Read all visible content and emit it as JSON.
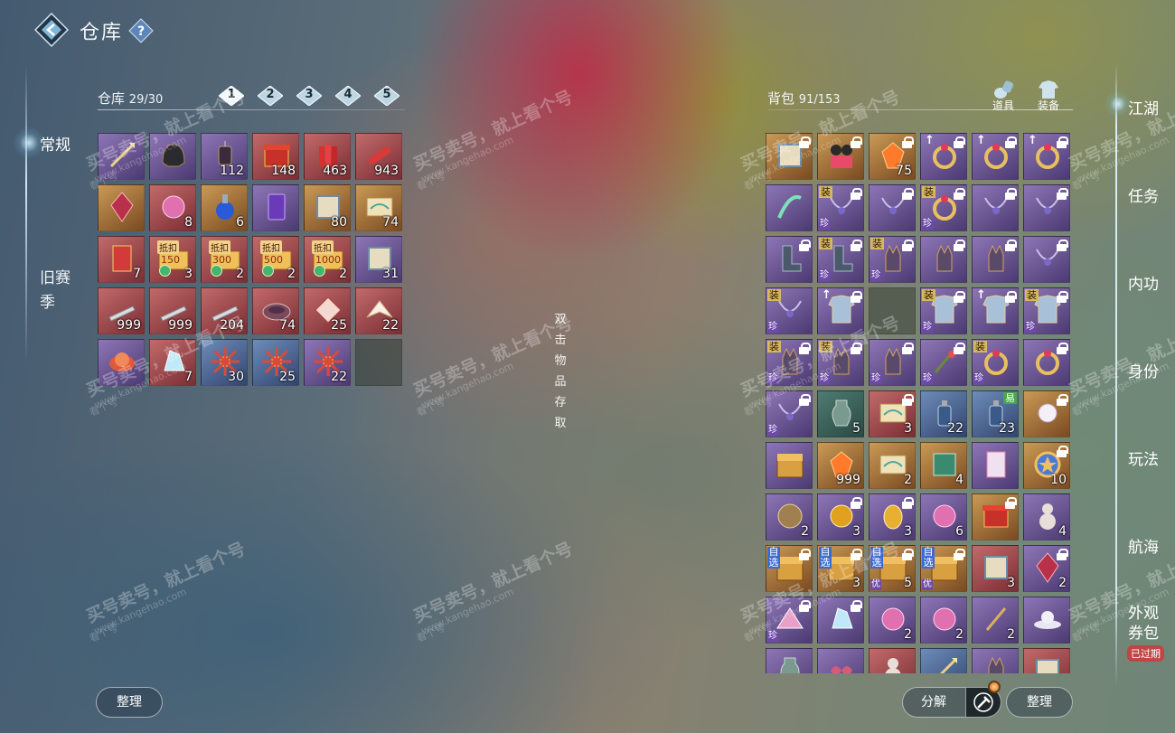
{
  "header": {
    "title": "仓库",
    "help": "?"
  },
  "left_nav": [
    {
      "label": "常规",
      "active": true
    },
    {
      "label": "旧赛季",
      "active": false
    }
  ],
  "warehouse": {
    "label": "仓库",
    "capacity": "29/30",
    "pages": [
      "1",
      "2",
      "3",
      "4",
      "5"
    ],
    "active_page": "1",
    "items": [
      {
        "c": "purple",
        "i": "spear",
        "n": ""
      },
      {
        "c": "purple",
        "i": "helmet",
        "n": ""
      },
      {
        "c": "purple",
        "i": "lantern",
        "n": "112"
      },
      {
        "c": "red",
        "i": "box",
        "n": "148"
      },
      {
        "c": "red",
        "i": "firecracker",
        "n": "463"
      },
      {
        "c": "red",
        "i": "scroll",
        "n": "943"
      },
      {
        "c": "gold",
        "i": "crystal",
        "n": ""
      },
      {
        "c": "red",
        "i": "orb",
        "n": "8"
      },
      {
        "c": "gold",
        "i": "potion",
        "n": "6"
      },
      {
        "c": "purple",
        "i": "card",
        "n": ""
      },
      {
        "c": "gold",
        "i": "book",
        "n": "80"
      },
      {
        "c": "gold",
        "i": "map",
        "n": "74"
      },
      {
        "c": "red",
        "i": "envelope",
        "n": "7"
      },
      {
        "c": "red",
        "i": "coupon",
        "n": "3",
        "tag": "抵扣",
        "val": "150"
      },
      {
        "c": "red",
        "i": "coupon",
        "n": "2",
        "tag": "抵扣",
        "val": "300"
      },
      {
        "c": "red",
        "i": "coupon",
        "n": "2",
        "tag": "抵扣",
        "val": "500"
      },
      {
        "c": "red",
        "i": "coupon",
        "n": "2",
        "tag": "抵扣",
        "val": "1000"
      },
      {
        "c": "purple",
        "i": "book",
        "n": "31"
      },
      {
        "c": "red",
        "i": "blade",
        "n": "999"
      },
      {
        "c": "red",
        "i": "blade",
        "n": "999"
      },
      {
        "c": "red",
        "i": "blade",
        "n": "204"
      },
      {
        "c": "red",
        "i": "bowl",
        "n": "74"
      },
      {
        "c": "red",
        "i": "kite",
        "n": "25"
      },
      {
        "c": "red",
        "i": "crane",
        "n": "22"
      },
      {
        "c": "purple",
        "i": "lotus",
        "n": ""
      },
      {
        "c": "red",
        "i": "ice",
        "n": "7"
      },
      {
        "c": "blue",
        "i": "star",
        "n": "30"
      },
      {
        "c": "blue",
        "i": "star",
        "n": "25"
      },
      {
        "c": "purple",
        "i": "star",
        "n": "22"
      },
      {
        "c": "empty",
        "i": "",
        "n": ""
      }
    ]
  },
  "hint": "双击物品存取",
  "bag": {
    "label": "背包",
    "capacity": "91/153",
    "tabs": [
      {
        "label": "道具",
        "icon": "potion-bag-icon"
      },
      {
        "label": "装备",
        "icon": "armor-icon"
      }
    ],
    "items": [
      {
        "c": "gold",
        "i": "book",
        "lk": 1
      },
      {
        "c": "gold",
        "i": "figures",
        "lk": 1
      },
      {
        "c": "gold",
        "i": "gem",
        "n": "75",
        "lk": 1
      },
      {
        "c": "purple",
        "i": "ring",
        "lk": 1,
        "up": 1
      },
      {
        "c": "purple",
        "i": "ring",
        "lk": 1,
        "up": 1
      },
      {
        "c": "purple",
        "i": "ring",
        "lk": 1,
        "up": 1
      },
      {
        "c": "purple",
        "i": "ribbon"
      },
      {
        "c": "purple",
        "i": "necklace",
        "lk": 1,
        "tl": "装",
        "bl": "珍"
      },
      {
        "c": "purple",
        "i": "necklace",
        "lk": 1
      },
      {
        "c": "purple",
        "i": "ring",
        "lk": 1,
        "tl": "装",
        "bl": "珍"
      },
      {
        "c": "purple",
        "i": "necklace",
        "lk": 1
      },
      {
        "c": "purple",
        "i": "necklace",
        "lk": 1
      },
      {
        "c": "purple",
        "i": "boots",
        "lk": 1
      },
      {
        "c": "purple",
        "i": "boots",
        "lk": 1,
        "tl": "装",
        "bl": "珍"
      },
      {
        "c": "purple",
        "i": "glove",
        "lk": 1,
        "tl": "装",
        "bl": "珍"
      },
      {
        "c": "purple",
        "i": "glove",
        "lk": 1
      },
      {
        "c": "purple",
        "i": "glove",
        "lk": 1
      },
      {
        "c": "purple",
        "i": "necklace",
        "lk": 1
      },
      {
        "c": "purple",
        "i": "necklace",
        "tl": "装",
        "bl": "珍"
      },
      {
        "c": "purple",
        "i": "armor",
        "lk": 1,
        "up": 1
      },
      {
        "c": "empty",
        "i": ""
      },
      {
        "c": "purple",
        "i": "armor",
        "lk": 1,
        "tl": "装",
        "bl": "珍"
      },
      {
        "c": "purple",
        "i": "armor",
        "lk": 1,
        "up": 1
      },
      {
        "c": "purple",
        "i": "armor",
        "lk": 1,
        "tl": "装",
        "bl": "珍"
      },
      {
        "c": "purple",
        "i": "glove",
        "lk": 1,
        "tl": "装",
        "bl": "珍"
      },
      {
        "c": "purple",
        "i": "glove",
        "lk": 1,
        "tl": "装",
        "bl": "珍"
      },
      {
        "c": "purple",
        "i": "glove",
        "lk": 1,
        "bl": "珍"
      },
      {
        "c": "purple",
        "i": "branch",
        "lk": 1,
        "bl": "珍"
      },
      {
        "c": "purple",
        "i": "ring",
        "tl": "装",
        "bl": "珍"
      },
      {
        "c": "purple",
        "i": "ring",
        "lk": 1
      },
      {
        "c": "purple",
        "i": "necklace",
        "lk": 1,
        "bl": "珍"
      },
      {
        "c": "green",
        "i": "vase",
        "n": "5"
      },
      {
        "c": "red",
        "i": "map",
        "n": "3",
        "lk": 1
      },
      {
        "c": "blue",
        "i": "bottle",
        "n": "22"
      },
      {
        "c": "blue",
        "i": "bottle",
        "n": "23",
        "tl2": "易"
      },
      {
        "c": "gold",
        "i": "pearl",
        "lk": 1
      },
      {
        "c": "purple",
        "i": "chest"
      },
      {
        "c": "gold",
        "i": "gem",
        "n": "999"
      },
      {
        "c": "gold",
        "i": "map",
        "n": "2"
      },
      {
        "c": "gold",
        "i": "stamp",
        "n": "4"
      },
      {
        "c": "purple",
        "i": "ticket"
      },
      {
        "c": "gold",
        "i": "medal",
        "n": "10",
        "lk": 1
      },
      {
        "c": "purple",
        "i": "disk",
        "n": "2"
      },
      {
        "c": "purple",
        "i": "coin",
        "n": "3",
        "lk": 1
      },
      {
        "c": "purple",
        "i": "egg",
        "n": "3",
        "lk": 1
      },
      {
        "c": "purple",
        "i": "orb",
        "n": "6"
      },
      {
        "c": "gold",
        "i": "box",
        "lk": 1
      },
      {
        "c": "purple",
        "i": "gourd",
        "n": "4"
      },
      {
        "c": "gold",
        "i": "chest",
        "lk": 1,
        "tlb": "自选"
      },
      {
        "c": "gold",
        "i": "chest",
        "n": "3",
        "lk": 1,
        "tlb": "自选"
      },
      {
        "c": "gold",
        "i": "chest",
        "n": "5",
        "lk": 1,
        "tlb": "自选",
        "bl": "优"
      },
      {
        "c": "gold",
        "i": "chest",
        "lk": 1,
        "tlb": "自选",
        "bl": "优"
      },
      {
        "c": "red",
        "i": "book",
        "n": "3"
      },
      {
        "c": "purple",
        "i": "crystal",
        "n": "2",
        "lk": 1
      },
      {
        "c": "purple",
        "i": "fan",
        "lk": 1,
        "bl": "珍"
      },
      {
        "c": "purple",
        "i": "ice",
        "lk": 1
      },
      {
        "c": "purple",
        "i": "orb",
        "n": "2"
      },
      {
        "c": "purple",
        "i": "orb",
        "n": "2"
      },
      {
        "c": "purple",
        "i": "pin",
        "n": "2"
      },
      {
        "c": "purple",
        "i": "hat"
      },
      {
        "c": "purple",
        "i": "vase"
      },
      {
        "c": "purple",
        "i": "bow"
      },
      {
        "c": "red",
        "i": "gourd"
      },
      {
        "c": "blue",
        "i": "spear"
      },
      {
        "c": "purple",
        "i": "glove"
      },
      {
        "c": "red",
        "i": "book"
      }
    ]
  },
  "right_nav": [
    {
      "label": "江湖",
      "active": true
    },
    {
      "label": "任务"
    },
    {
      "label": "内功"
    },
    {
      "label": "身份"
    },
    {
      "label": "玩法"
    },
    {
      "label": "航海"
    },
    {
      "label": "外观\n券包",
      "badge": "已过期"
    }
  ],
  "buttons": {
    "sort_left": "整理",
    "decompose": "分解",
    "sort_right": "整理"
  },
  "watermark": {
    "line1": "买号卖号，就上看个号",
    "line2": "www.kangehao.com",
    "line3": "看个号"
  }
}
